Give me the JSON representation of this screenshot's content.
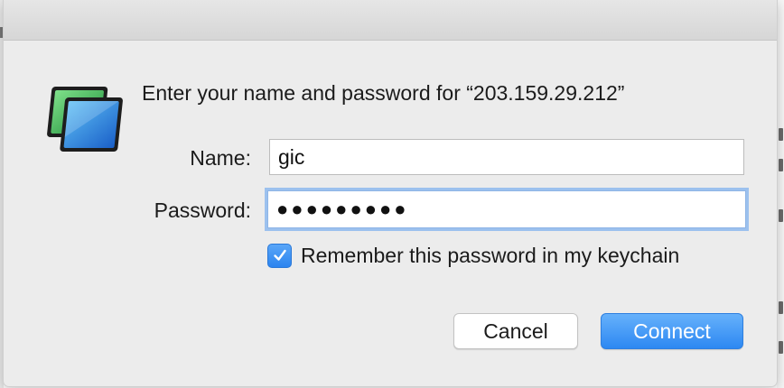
{
  "dialog": {
    "prompt": "Enter your name and password for “203.159.29.212”",
    "app_icon": "screen-sharing-icon"
  },
  "form": {
    "name_label": "Name:",
    "name_value": "gic",
    "password_label": "Password:",
    "password_masked": "●●●●●●●●●",
    "remember_label": "Remember this password in my keychain",
    "remember_checked": true
  },
  "buttons": {
    "cancel_label": "Cancel",
    "connect_label": "Connect"
  },
  "colors": {
    "accent": "#2d88f2",
    "sheet_background": "#ececec",
    "focus_ring": "#9cc1ee"
  }
}
